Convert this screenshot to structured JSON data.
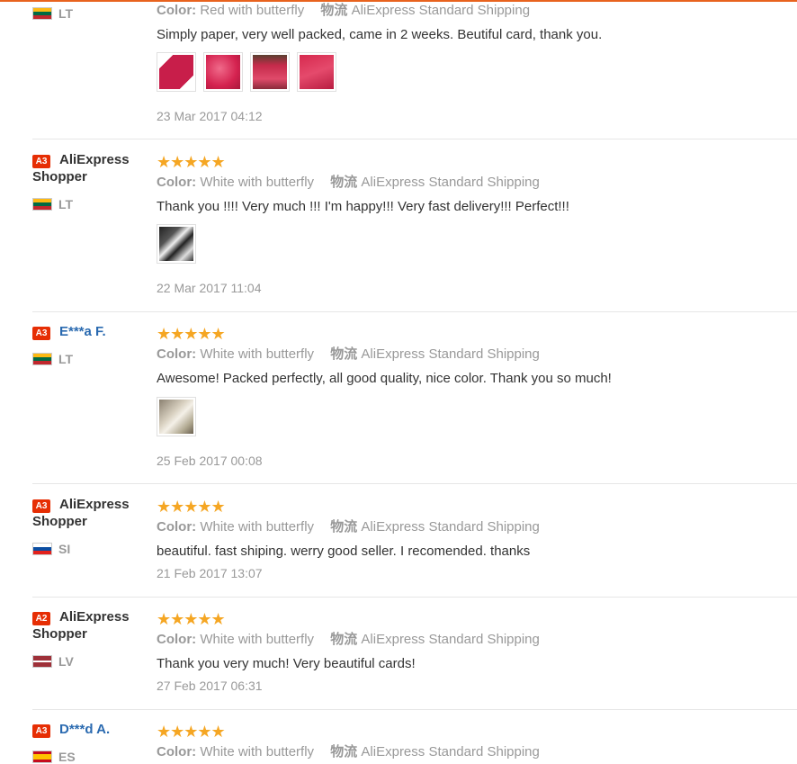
{
  "labels": {
    "color": "Color:",
    "shipping": "物流"
  },
  "stars": "★★★★★",
  "reviews": [
    {
      "level": "",
      "name": "",
      "country": "LT",
      "color": "Red with butterfly",
      "shipping": "AliExpress Standard Shipping",
      "text": "Simply paper, very well packed, came in 2 weeks. Beutiful card, thank you.",
      "date": "23 Mar 2017 04:12",
      "photos": [
        "red card front",
        "red card lace",
        "red card ribbon",
        "red card open"
      ]
    },
    {
      "level": "A3",
      "name": "AliExpress Shopper",
      "country": "LT",
      "color": "White with butterfly",
      "shipping": "AliExpress Standard Shipping",
      "text": "Thank you !!!! Very much !!! I'm happy!!! Very fast delivery!!! Perfect!!!",
      "date": "22 Mar 2017 11:04",
      "photos": [
        "white cards"
      ]
    },
    {
      "level": "A3",
      "name": "E***a F.",
      "country": "LT",
      "color": "White with butterfly",
      "shipping": "AliExpress Standard Shipping",
      "text": "Awesome! Packed perfectly, all good quality, nice color. Thank you so much!",
      "date": "25 Feb 2017 00:08",
      "photos": [
        "white lace card"
      ]
    },
    {
      "level": "A3",
      "name": "AliExpress Shopper",
      "country": "SI",
      "color": "White with butterfly",
      "shipping": "AliExpress Standard Shipping",
      "text": "beautiful. fast shiping. werry good seller. I recomended. thanks",
      "date": "21 Feb 2017 13:07",
      "photos": []
    },
    {
      "level": "A2",
      "name": "AliExpress Shopper",
      "country": "LV",
      "color": "White with butterfly",
      "shipping": "AliExpress Standard Shipping",
      "text": "Thank you very much! Very beautiful cards!",
      "date": "27 Feb 2017 06:31",
      "photos": []
    },
    {
      "level": "A3",
      "name": "D***d A.",
      "country": "ES",
      "color": "White with butterfly",
      "shipping": "AliExpress Standard Shipping",
      "text": "",
      "date": "",
      "photos": []
    }
  ]
}
